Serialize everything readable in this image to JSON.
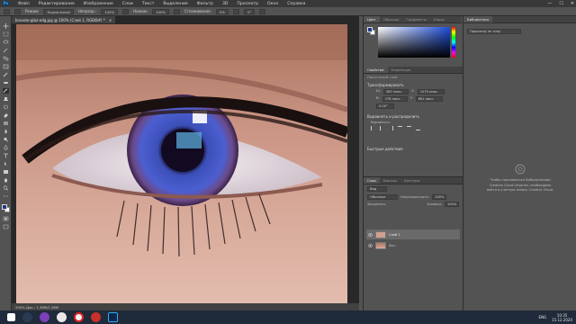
{
  "menu": {
    "logo": "Ps",
    "items": [
      "Файл",
      "Редактирование",
      "Изображение",
      "Слои",
      "Текст",
      "Выделение",
      "Фильтр",
      "3D",
      "Просмотр",
      "Окно",
      "Справка"
    ]
  },
  "window_controls": {
    "minimize": "—",
    "maximize": "☐",
    "close": "✕"
  },
  "options": {
    "mode_label": "Режим:",
    "mode_value": "Нормальный",
    "opacity_label": "Непрозр.:",
    "opacity_value": "100%",
    "flow_label": "Нажим:",
    "flow_value": "100%",
    "smoothing_label": "Сглаживание:",
    "smoothing_value": "0%",
    "angle_value": "0°"
  },
  "document": {
    "tab_title": "bravoto-glaz-edg.jpg @ 200% (Слой 1, RGB/8#) *",
    "close": "×",
    "status": "200%   Док.: 1,38M/1,38M"
  },
  "color_panel": {
    "tabs": [
      "Цвет",
      "Образцы",
      "Градиенты",
      "Узоры"
    ],
    "fg": "#1e3a8a",
    "bg": "#ffffff"
  },
  "properties_panel": {
    "tabs": [
      "Свойства",
      "Коррекция"
    ],
    "layer_type": "Пиксельный слой",
    "transform_title": "Трансформировать",
    "w_label": "Ш:",
    "w_value": "387 пикс.",
    "x_label": "X:",
    "x_value": "1575 пикс.",
    "h_label": "В:",
    "h_value": "278 пикс.",
    "y_label": "Y:",
    "y_value": "881 пикс.",
    "angle_value": "0,00°",
    "align_title": "Выровнять и распределить",
    "align_label": "Выровнять:",
    "quick_actions": "Быстрые действия"
  },
  "layers_panel": {
    "tabs": [
      "Слои",
      "Каналы",
      "Контуры"
    ],
    "filter_label": "Вид",
    "blend_mode": "Обычные",
    "opacity_label": "Непрозрачность:",
    "opacity_value": "100%",
    "lock_label": "Закрепить:",
    "fill_label": "Заливка:",
    "fill_value": "100%",
    "layers": [
      {
        "name": "Слой 1",
        "selected": true
      },
      {
        "name": "Фон",
        "selected": false
      }
    ]
  },
  "library_panel": {
    "tab": "Библиотеки",
    "dropdown": "Просмотр по типу",
    "message_lines": [
      "Чтобы пользоваться библиотеками",
      "Creative Cloud Libraries, необходимо",
      "войти в учетную запись Creative Cloud."
    ]
  },
  "taskbar": {
    "language": "ENG",
    "time": "10:35",
    "date": "15.12.2020"
  }
}
